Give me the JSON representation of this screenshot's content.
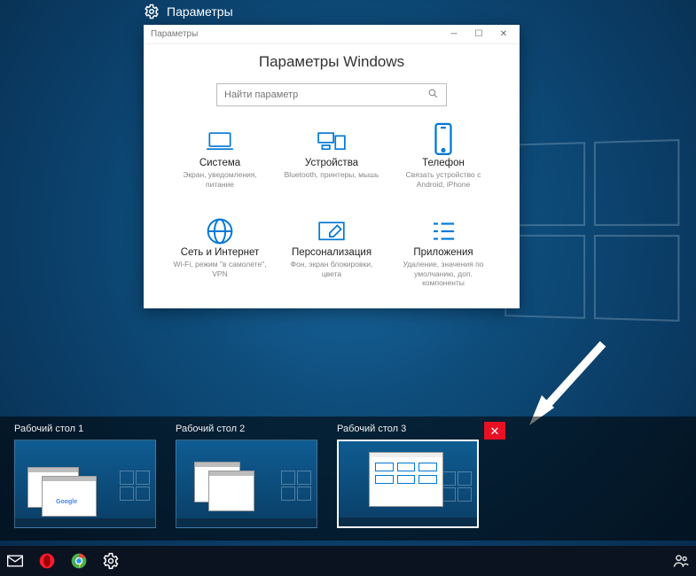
{
  "topbar": {
    "title": "Параметры"
  },
  "settings_window": {
    "chrome_title": "Параметры",
    "heading": "Параметры Windows",
    "search_placeholder": "Найти параметр",
    "tiles": [
      {
        "title": "Система",
        "sub": "Экран, уведомления, питание",
        "icon": "laptop-icon"
      },
      {
        "title": "Устройства",
        "sub": "Bluetooth, принтеры, мышь",
        "icon": "devices-icon"
      },
      {
        "title": "Телефон",
        "sub": "Связать устройство с Android, iPhone",
        "icon": "phone-icon"
      },
      {
        "title": "Сеть и Интернет",
        "sub": "Wi-Fi, режим \"в самолете\", VPN",
        "icon": "globe-icon"
      },
      {
        "title": "Персонализация",
        "sub": "Фон, экран блокировки, цвета",
        "icon": "personalization-icon"
      },
      {
        "title": "Приложения",
        "sub": "Удаление, значения по умолчанию, доп. компоненты",
        "icon": "apps-icon"
      }
    ]
  },
  "taskview": {
    "desktops": [
      {
        "label": "Рабочий стол 1",
        "active": false
      },
      {
        "label": "Рабочий стол 2",
        "active": false
      },
      {
        "label": "Рабочий стол 3",
        "active": true,
        "closable": true
      }
    ]
  },
  "taskbar": {
    "icons": [
      "mail-icon",
      "opera-icon",
      "chrome-icon",
      "settings-gear-icon"
    ],
    "right_icon": "people-icon"
  },
  "colors": {
    "accent": "#0078d7",
    "close_red": "#e81123"
  }
}
